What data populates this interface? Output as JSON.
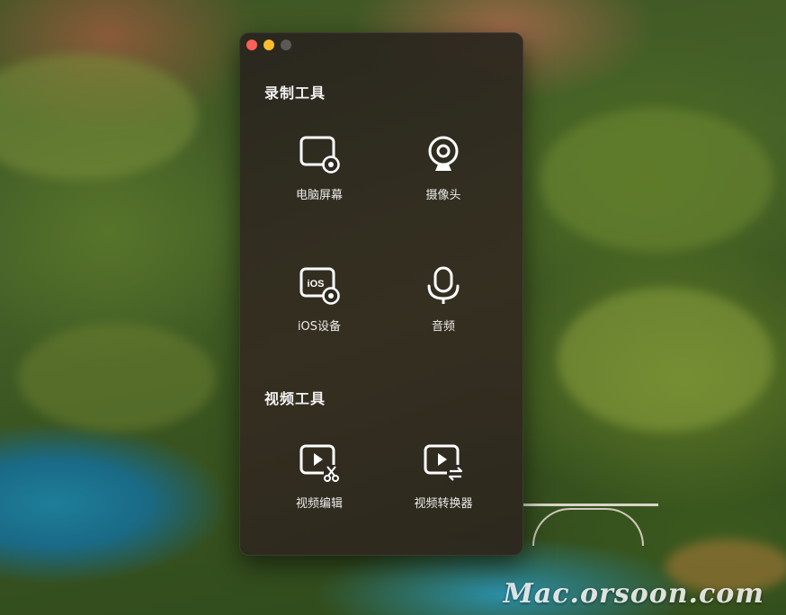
{
  "window": {
    "controls": [
      "close",
      "minimize",
      "zoom"
    ]
  },
  "sections": {
    "recording": {
      "title": "录制工具",
      "tools": [
        {
          "label": "电脑屏幕",
          "icon": "screen-record-icon"
        },
        {
          "label": "摄像头",
          "icon": "webcam-icon"
        },
        {
          "label": "iOS设备",
          "icon": "ios-device-icon"
        },
        {
          "label": "音频",
          "icon": "microphone-icon"
        }
      ]
    },
    "video": {
      "title": "视频工具",
      "tools": [
        {
          "label": "视频编辑",
          "icon": "video-edit-icon"
        },
        {
          "label": "视频转换器",
          "icon": "video-convert-icon"
        }
      ]
    }
  },
  "ios_badge": "iOS",
  "watermark": "Mac.orsoon.com",
  "colors": {
    "close": "#fe5f57",
    "minimize": "#febc2e",
    "zoom_inactive": "#5b5955",
    "window_bg": "#2c2820",
    "text": "#ececec"
  }
}
